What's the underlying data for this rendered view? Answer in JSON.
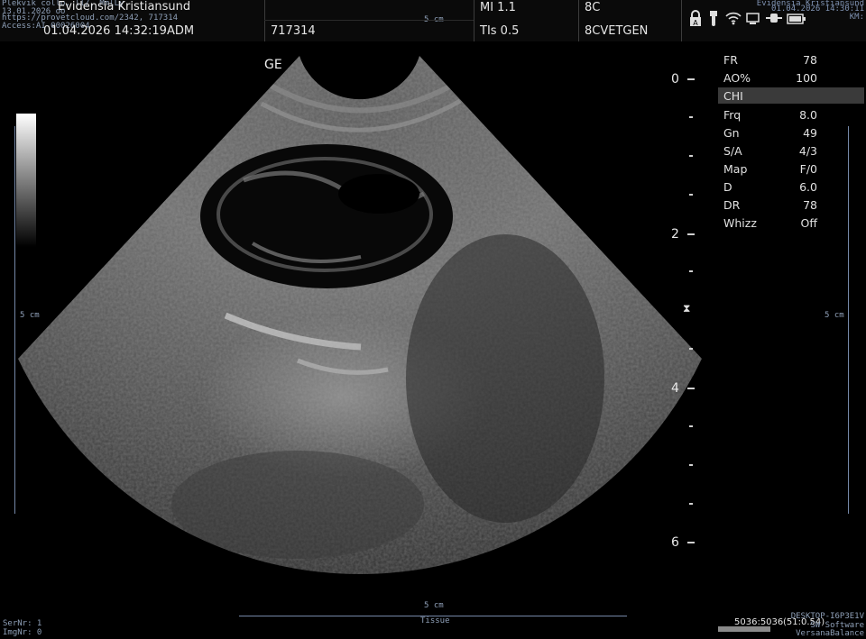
{
  "header": {
    "clinic_line": "Plekvik collo, ll/, MmlLy",
    "clinic_name": "Evidensia Kristiansund",
    "date_line": "13.01.2026 oo",
    "patient_url": "https://provetcloud.com/2342, 717314",
    "accession": "Access:AI-00026004",
    "datetime": "01.04.2026  14:32:19ADM",
    "patient_id": "717314",
    "mi": "MI 1.1",
    "tis": "TIs 0.5",
    "probe": "8C",
    "preset": "8CVETGEN",
    "top_scale_label": "5 cm",
    "right_clinic": "Evidensia Kristiansund",
    "right_datetime": "01.04.2026 14:30:11",
    "right_km": "KM:"
  },
  "status_icons": [
    "lock-icon",
    "usb-icon",
    "wifi-icon",
    "network-icon",
    "power-plug-icon",
    "battery-icon"
  ],
  "image": {
    "brand": "GE",
    "left_scale_label": "5 cm",
    "right_scale_label": "5 cm",
    "bottom_scale_label": "5 cm",
    "bottom_mode": "Tissue",
    "depth_marks": [
      "0",
      "2",
      "4",
      "6"
    ]
  },
  "params": [
    {
      "key": "FR",
      "value": "78"
    },
    {
      "key": "AO%",
      "value": "100"
    },
    {
      "key": "CHI",
      "value": "",
      "highlight": true
    },
    {
      "key": "Frq",
      "value": "8.0"
    },
    {
      "key": "Gn",
      "value": "49"
    },
    {
      "key": "S/A",
      "value": "4/3"
    },
    {
      "key": "Map",
      "value": "F/0"
    },
    {
      "key": "D",
      "value": "6.0"
    },
    {
      "key": "DR",
      "value": "78"
    },
    {
      "key": "Whizz",
      "value": "Off"
    }
  ],
  "footer": {
    "ser_nr": "SerNr: 1",
    "img_nr": "ImgNr: 0",
    "frame_counter": "5036:5036",
    "frame_extra": "(51:0.54)",
    "desktop": "DESKTOP-I6P3E1V",
    "sw_line": "SW Software",
    "product": "VersanaBalance"
  },
  "colors": {
    "background": "#000000",
    "scale_blue": "#7588a8",
    "highlight": "#3a3a3a"
  }
}
